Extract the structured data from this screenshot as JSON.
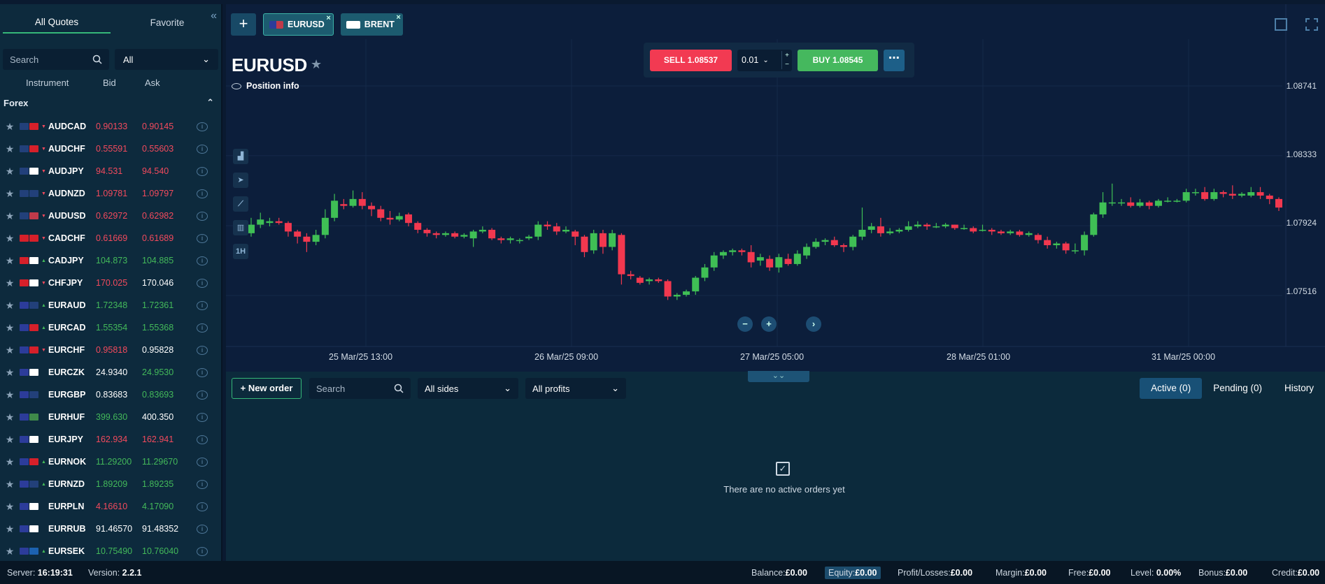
{
  "left_panel": {
    "tabs": [
      "All Quotes",
      "Favorite"
    ],
    "search_placeholder": "Search",
    "filter_value": "All",
    "columns": [
      "Instrument",
      "Bid",
      "Ask"
    ],
    "group": "Forex",
    "quotes": [
      {
        "symbol": "AUDCAD",
        "bid": "0.90133",
        "ask": "0.90145",
        "bid_color": "down",
        "ask_color": "down",
        "dir": "down",
        "flags": [
          "#22407a",
          "#d6202a"
        ]
      },
      {
        "symbol": "AUDCHF",
        "bid": "0.55591",
        "ask": "0.55603",
        "bid_color": "down",
        "ask_color": "down",
        "dir": "down",
        "flags": [
          "#22407a",
          "#d6202a"
        ]
      },
      {
        "symbol": "AUDJPY",
        "bid": "94.531",
        "ask": "94.540",
        "bid_color": "down",
        "ask_color": "down",
        "dir": "down",
        "flags": [
          "#22407a",
          "#ffffff"
        ]
      },
      {
        "symbol": "AUDNZD",
        "bid": "1.09781",
        "ask": "1.09797",
        "bid_color": "down",
        "ask_color": "down",
        "dir": "down",
        "flags": [
          "#22407a",
          "#22407a"
        ]
      },
      {
        "symbol": "AUDUSD",
        "bid": "0.62972",
        "ask": "0.62982",
        "bid_color": "down",
        "ask_color": "down",
        "dir": "down",
        "flags": [
          "#22407a",
          "#bf3a4a"
        ]
      },
      {
        "symbol": "CADCHF",
        "bid": "0.61669",
        "ask": "0.61689",
        "bid_color": "down",
        "ask_color": "down",
        "dir": "down",
        "flags": [
          "#d6202a",
          "#d6202a"
        ]
      },
      {
        "symbol": "CADJPY",
        "bid": "104.873",
        "ask": "104.885",
        "bid_color": "up",
        "ask_color": "up",
        "dir": "up",
        "flags": [
          "#d6202a",
          "#ffffff"
        ]
      },
      {
        "symbol": "CHFJPY",
        "bid": "170.025",
        "ask": "170.046",
        "bid_color": "down",
        "ask_color": "flat",
        "dir": "down",
        "flags": [
          "#d6202a",
          "#ffffff"
        ]
      },
      {
        "symbol": "EURAUD",
        "bid": "1.72348",
        "ask": "1.72361",
        "bid_color": "up",
        "ask_color": "up",
        "dir": "up",
        "flags": [
          "#2c3c9a",
          "#22407a"
        ]
      },
      {
        "symbol": "EURCAD",
        "bid": "1.55354",
        "ask": "1.55368",
        "bid_color": "up",
        "ask_color": "up",
        "dir": "up",
        "flags": [
          "#2c3c9a",
          "#d6202a"
        ]
      },
      {
        "symbol": "EURCHF",
        "bid": "0.95818",
        "ask": "0.95828",
        "bid_color": "down",
        "ask_color": "flat",
        "dir": "down",
        "flags": [
          "#2c3c9a",
          "#d6202a"
        ]
      },
      {
        "symbol": "EURCZK",
        "bid": "24.9340",
        "ask": "24.9530",
        "bid_color": "flat",
        "ask_color": "up",
        "dir": "",
        "flags": [
          "#2c3c9a",
          "#ffffff"
        ]
      },
      {
        "symbol": "EURGBP",
        "bid": "0.83683",
        "ask": "0.83693",
        "bid_color": "flat",
        "ask_color": "up",
        "dir": "",
        "flags": [
          "#2c3c9a",
          "#22407a"
        ]
      },
      {
        "symbol": "EURHUF",
        "bid": "399.630",
        "ask": "400.350",
        "bid_color": "up",
        "ask_color": "flat",
        "dir": "",
        "flags": [
          "#2c3c9a",
          "#3f8a4a"
        ]
      },
      {
        "symbol": "EURJPY",
        "bid": "162.934",
        "ask": "162.941",
        "bid_color": "down",
        "ask_color": "down",
        "dir": "",
        "flags": [
          "#2c3c9a",
          "#ffffff"
        ]
      },
      {
        "symbol": "EURNOK",
        "bid": "11.29200",
        "ask": "11.29670",
        "bid_color": "up",
        "ask_color": "up",
        "dir": "up",
        "flags": [
          "#2c3c9a",
          "#d6202a"
        ]
      },
      {
        "symbol": "EURNZD",
        "bid": "1.89209",
        "ask": "1.89235",
        "bid_color": "up",
        "ask_color": "up",
        "dir": "up",
        "flags": [
          "#2c3c9a",
          "#22407a"
        ]
      },
      {
        "symbol": "EURPLN",
        "bid": "4.16610",
        "ask": "4.17090",
        "bid_color": "down",
        "ask_color": "up",
        "dir": "",
        "flags": [
          "#2c3c9a",
          "#ffffff"
        ]
      },
      {
        "symbol": "EURRUB",
        "bid": "91.46570",
        "ask": "91.48352",
        "bid_color": "flat",
        "ask_color": "flat",
        "dir": "",
        "flags": [
          "#2c3c9a",
          "#ffffff"
        ]
      },
      {
        "symbol": "EURSEK",
        "bid": "10.75490",
        "ask": "10.76040",
        "bid_color": "up",
        "ask_color": "up",
        "dir": "up",
        "flags": [
          "#2c3c9a",
          "#1c62b0"
        ]
      }
    ]
  },
  "top_tabs": {
    "tabs": [
      {
        "label": "EURUSD",
        "active": true
      },
      {
        "label": "BRENT",
        "active": false
      }
    ]
  },
  "chart": {
    "instrument": "EURUSD",
    "position_info": "Position info",
    "sell_label": "SELL 1.08537",
    "buy_label": "BUY 1.08545",
    "lot_value": "0.01",
    "tools": [
      "1H"
    ],
    "price_ticks": [
      "1.08741",
      "1.08333",
      "1.07924",
      "1.07516"
    ],
    "time_ticks": [
      "25 Mar/25 13:00",
      "26 Mar/25 09:00",
      "27 Mar/25 05:00",
      "28 Mar/25 01:00",
      "31 Mar/25 00:00"
    ]
  },
  "chart_data": {
    "type": "candlestick",
    "title": "EURUSD",
    "y_ticks": [
      1.08741,
      1.08333,
      1.07924,
      1.07516
    ],
    "x_ticks": [
      "25 Mar/25 13:00",
      "26 Mar/25 09:00",
      "27 Mar/25 05:00",
      "28 Mar/25 01:00",
      "31 Mar/25 00:00"
    ],
    "colors": {
      "up": "#3fbf55",
      "down": "#f2384f"
    },
    "candles": [
      [
        1.0788,
        1.0793,
        1.0786,
        1.0797
      ],
      [
        1.0793,
        1.0796,
        1.0791,
        1.08
      ],
      [
        1.0794,
        1.0795,
        1.0792,
        1.0797
      ],
      [
        1.0795,
        1.0794,
        1.0793,
        1.0797
      ],
      [
        1.0794,
        1.0789,
        1.0786,
        1.0795
      ],
      [
        1.0789,
        1.0786,
        1.0782,
        1.079
      ],
      [
        1.0786,
        1.0783,
        1.0777,
        1.0788
      ],
      [
        1.0783,
        1.0787,
        1.0781,
        1.079
      ],
      [
        1.0787,
        1.0797,
        1.0785,
        1.0802
      ],
      [
        1.0797,
        1.0807,
        1.0795,
        1.0811
      ],
      [
        1.0805,
        1.0804,
        1.0802,
        1.0808
      ],
      [
        1.0804,
        1.0808,
        1.0803,
        1.0813
      ],
      [
        1.0808,
        1.0804,
        1.0802,
        1.0812
      ],
      [
        1.0804,
        1.0802,
        1.0798,
        1.0806
      ],
      [
        1.0802,
        1.0797,
        1.0795,
        1.0804
      ],
      [
        1.0797,
        1.0796,
        1.0793,
        1.0801
      ],
      [
        1.0796,
        1.0798,
        1.0795,
        1.08
      ],
      [
        1.0799,
        1.0794,
        1.0792,
        1.08
      ],
      [
        1.0794,
        1.079,
        1.0788,
        1.0795
      ],
      [
        1.079,
        1.0788,
        1.0786,
        1.0791
      ],
      [
        1.0788,
        1.0787,
        1.0785,
        1.0789
      ],
      [
        1.0787,
        1.0788,
        1.0786,
        1.0789
      ],
      [
        1.0788,
        1.0786,
        1.0785,
        1.0789
      ],
      [
        1.0786,
        1.0787,
        1.0785,
        1.0788
      ],
      [
        1.0785,
        1.0789,
        1.078,
        1.079
      ],
      [
        1.0789,
        1.079,
        1.0788,
        1.0792
      ],
      [
        1.079,
        1.0785,
        1.0784,
        1.0791
      ],
      [
        1.0785,
        1.0784,
        1.0782,
        1.0786
      ],
      [
        1.0784,
        1.0785,
        1.0782,
        1.0786
      ],
      [
        1.0784,
        1.0784,
        1.0782,
        1.0785
      ],
      [
        1.0785,
        1.0786,
        1.0784,
        1.0787
      ],
      [
        1.0786,
        1.0793,
        1.0784,
        1.0795
      ],
      [
        1.0793,
        1.0792,
        1.079,
        1.0795
      ],
      [
        1.0792,
        1.0789,
        1.0787,
        1.0794
      ],
      [
        1.0789,
        1.079,
        1.0788,
        1.0792
      ],
      [
        1.0789,
        1.0786,
        1.0781,
        1.079
      ],
      [
        1.0786,
        1.0777,
        1.0774,
        1.0787
      ],
      [
        1.0778,
        1.0788,
        1.0776,
        1.079
      ],
      [
        1.0788,
        1.078,
        1.0776,
        1.079
      ],
      [
        1.078,
        1.0788,
        1.0778,
        1.079
      ],
      [
        1.0787,
        1.0764,
        1.0758,
        1.0788
      ],
      [
        1.0764,
        1.0763,
        1.0761,
        1.0766
      ],
      [
        1.0762,
        1.0759,
        1.0758,
        1.0763
      ],
      [
        1.076,
        1.0761,
        1.0758,
        1.0762
      ],
      [
        1.0761,
        1.076,
        1.0759,
        1.0762
      ],
      [
        1.076,
        1.0751,
        1.0749,
        1.0761
      ],
      [
        1.0751,
        1.0752,
        1.0749,
        1.0753
      ],
      [
        1.0752,
        1.0754,
        1.0751,
        1.0755
      ],
      [
        1.0754,
        1.0762,
        1.0752,
        1.0763
      ],
      [
        1.0762,
        1.0768,
        1.076,
        1.077
      ],
      [
        1.0768,
        1.0775,
        1.0766,
        1.0777
      ],
      [
        1.0775,
        1.0777,
        1.0773,
        1.0778
      ],
      [
        1.0777,
        1.0778,
        1.0775,
        1.0779
      ],
      [
        1.0778,
        1.0777,
        1.0775,
        1.0779
      ],
      [
        1.0777,
        1.0771,
        1.0768,
        1.0781
      ],
      [
        1.0772,
        1.0774,
        1.0769,
        1.0776
      ],
      [
        1.0773,
        1.0768,
        1.0766,
        1.0775
      ],
      [
        1.0768,
        1.0774,
        1.0765,
        1.0776
      ],
      [
        1.0773,
        1.077,
        1.0769,
        1.0776
      ],
      [
        1.077,
        1.0776,
        1.0769,
        1.0778
      ],
      [
        1.0775,
        1.078,
        1.0773,
        1.0782
      ],
      [
        1.078,
        1.0783,
        1.0779,
        1.0785
      ],
      [
        1.0783,
        1.0784,
        1.0781,
        1.0785
      ],
      [
        1.0784,
        1.0781,
        1.078,
        1.0786
      ],
      [
        1.0781,
        1.078,
        1.0777,
        1.0782
      ],
      [
        1.078,
        1.0786,
        1.0778,
        1.0787
      ],
      [
        1.0786,
        1.079,
        1.0784,
        1.0803
      ],
      [
        1.079,
        1.0792,
        1.0788,
        1.0794
      ],
      [
        1.0792,
        1.0788,
        1.0786,
        1.0797
      ],
      [
        1.0788,
        1.0789,
        1.0787,
        1.0791
      ],
      [
        1.0789,
        1.079,
        1.0788,
        1.0791
      ],
      [
        1.079,
        1.0792,
        1.0789,
        1.0795
      ],
      [
        1.0792,
        1.0793,
        1.0791,
        1.0795
      ],
      [
        1.0793,
        1.0792,
        1.079,
        1.0794
      ],
      [
        1.0792,
        1.0792,
        1.0791,
        1.0794
      ],
      [
        1.0792,
        1.0793,
        1.0791,
        1.0794
      ],
      [
        1.0793,
        1.0791,
        1.079,
        1.0793
      ],
      [
        1.0791,
        1.0791,
        1.079,
        1.0793
      ],
      [
        1.0791,
        1.0789,
        1.0788,
        1.0792
      ],
      [
        1.079,
        1.079,
        1.0789,
        1.0793
      ],
      [
        1.079,
        1.0789,
        1.0787,
        1.0791
      ],
      [
        1.0789,
        1.0788,
        1.0787,
        1.079
      ],
      [
        1.0788,
        1.0789,
        1.0787,
        1.079
      ],
      [
        1.0789,
        1.0787,
        1.0786,
        1.079
      ],
      [
        1.0787,
        1.0788,
        1.0786,
        1.0789
      ],
      [
        1.0787,
        1.0784,
        1.0782,
        1.0788
      ],
      [
        1.0784,
        1.0781,
        1.0779,
        1.0786
      ],
      [
        1.0781,
        1.0782,
        1.0779,
        1.0783
      ],
      [
        1.0782,
        1.0778,
        1.0776,
        1.0783
      ],
      [
        1.0778,
        1.0778,
        1.0776,
        1.0782
      ],
      [
        1.0778,
        1.0787,
        1.0775,
        1.0789
      ],
      [
        1.0787,
        1.0799,
        1.0786,
        1.08
      ],
      [
        1.0799,
        1.0806,
        1.0797,
        1.0812
      ],
      [
        1.0806,
        1.0806,
        1.0804,
        1.0817
      ],
      [
        1.0806,
        1.0806,
        1.0804,
        1.0808
      ],
      [
        1.0806,
        1.0804,
        1.0803,
        1.0809
      ],
      [
        1.0804,
        1.0806,
        1.0803,
        1.0808
      ],
      [
        1.0806,
        1.0804,
        1.0802,
        1.0807
      ],
      [
        1.0804,
        1.0807,
        1.0803,
        1.0808
      ],
      [
        1.0807,
        1.0807,
        1.0806,
        1.0809
      ],
      [
        1.0807,
        1.0807,
        1.0806,
        1.0808
      ],
      [
        1.0807,
        1.0812,
        1.0806,
        1.0814
      ],
      [
        1.0812,
        1.0812,
        1.081,
        1.0814
      ],
      [
        1.0812,
        1.0808,
        1.0807,
        1.0815
      ],
      [
        1.0808,
        1.0812,
        1.0807,
        1.0814
      ],
      [
        1.0812,
        1.0811,
        1.0809,
        1.0813
      ],
      [
        1.0811,
        1.081,
        1.0808,
        1.0816
      ],
      [
        1.081,
        1.0811,
        1.0809,
        1.0812
      ],
      [
        1.081,
        1.0812,
        1.0809,
        1.0815
      ],
      [
        1.0812,
        1.081,
        1.0808,
        1.0815
      ],
      [
        1.081,
        1.0808,
        1.0805,
        1.0811
      ],
      [
        1.0808,
        1.0803,
        1.0801,
        1.0809
      ]
    ]
  },
  "orders": {
    "new_order": "New order",
    "search_placeholder": "Search",
    "sides": "All sides",
    "profits": "All profits",
    "tabs": [
      "Active (0)",
      "Pending (0)",
      "History"
    ],
    "empty_text": "There are no active orders yet"
  },
  "status": {
    "server_label": "Server:",
    "server_time": "16:19:31",
    "version_label": "Version:",
    "version": "2.2.1",
    "balance_label": "Balance:",
    "balance": "£0.00",
    "equity_label": "Equity:",
    "equity": "£0.00",
    "pl_label": "Profit/Losses:",
    "pl": "£0.00",
    "margin_label": "Margin:",
    "margin": "£0.00",
    "free_label": "Free:",
    "free": "£0.00",
    "level_label": "Level:",
    "level": "0.00%",
    "bonus_label": "Bonus:",
    "bonus": "£0.00",
    "credit_label": "Credit:",
    "credit": "£0.00"
  }
}
